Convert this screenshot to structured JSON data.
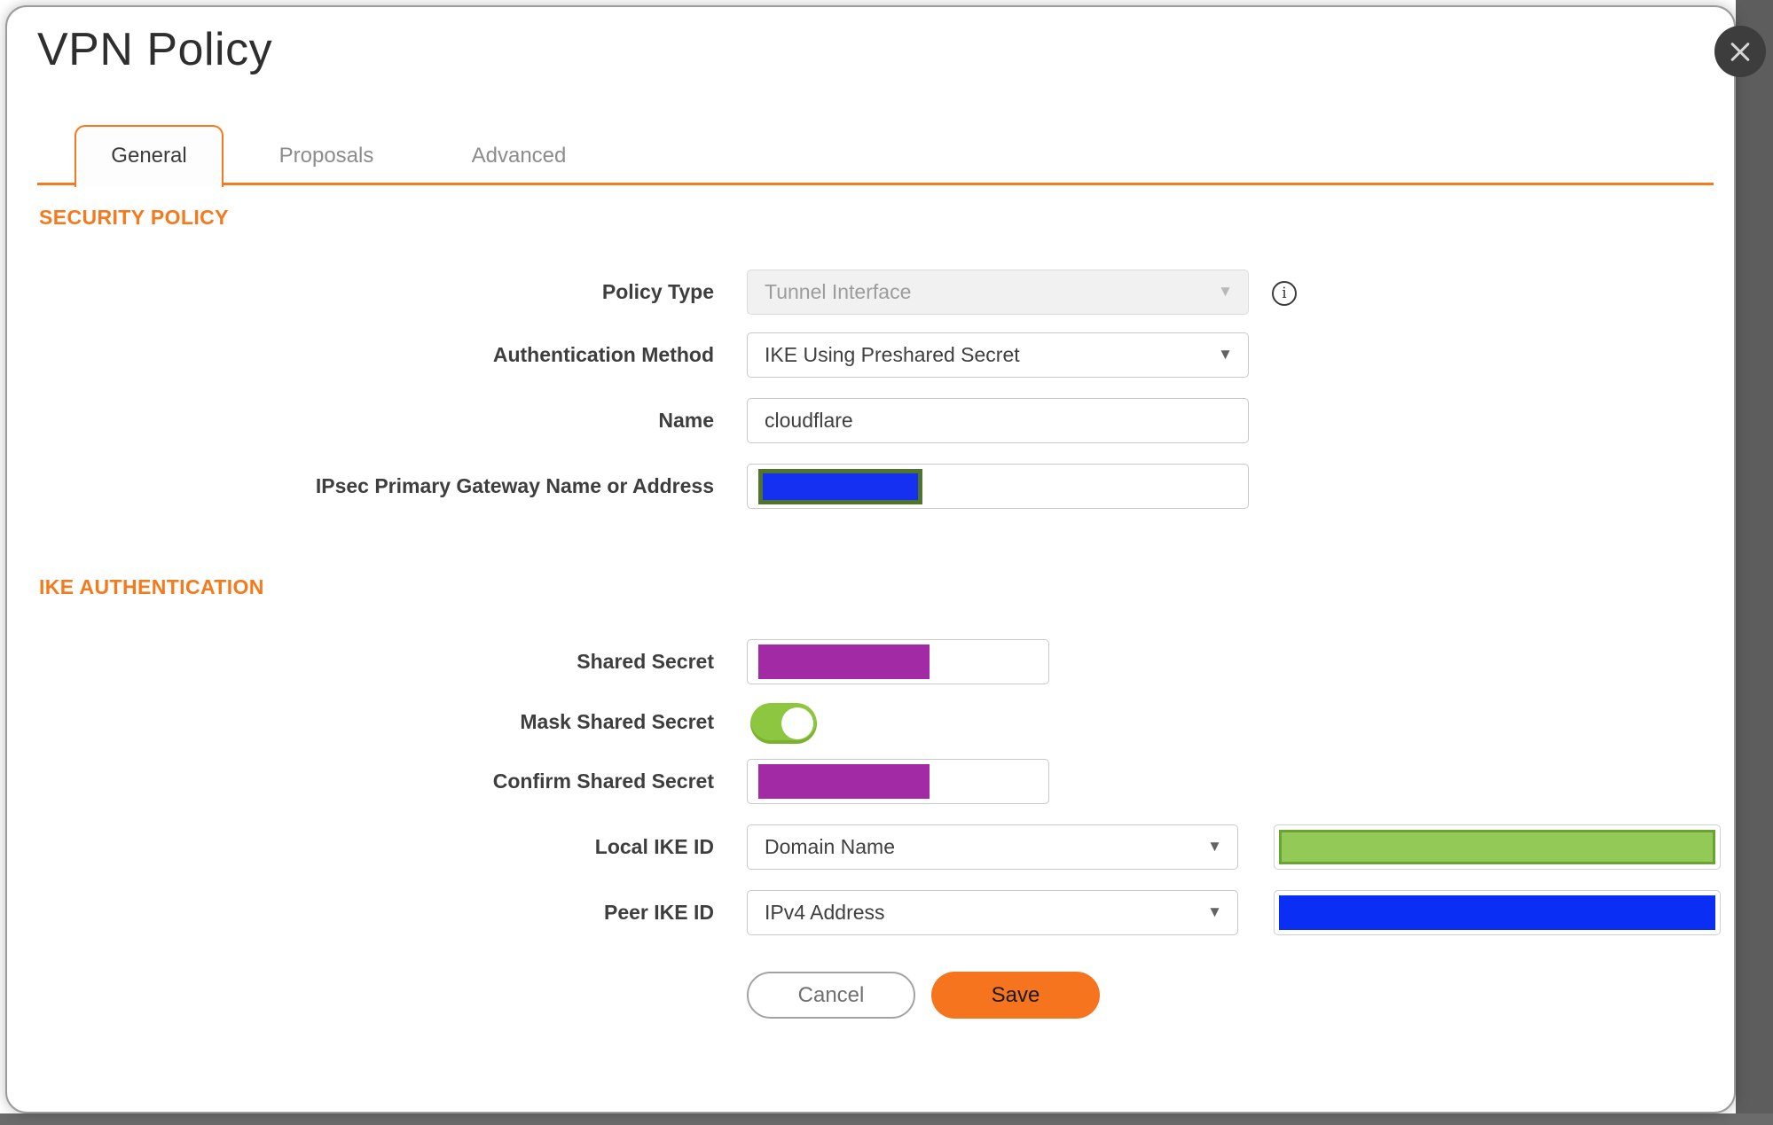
{
  "title": "VPN Policy",
  "tabs": {
    "general": "General",
    "proposals": "Proposals",
    "advanced": "Advanced",
    "active_tab": "General"
  },
  "sections": {
    "security_policy": "SECURITY POLICY",
    "ike_authentication": "IKE AUTHENTICATION"
  },
  "fields": {
    "policy_type": {
      "label": "Policy Type",
      "value": "Tunnel Interface",
      "disabled": true
    },
    "authentication_method": {
      "label": "Authentication Method",
      "value": "IKE Using Preshared Secret"
    },
    "name": {
      "label": "Name",
      "value": "cloudflare"
    },
    "ipsec_gateway": {
      "label": "IPsec Primary Gateway Name or Address",
      "value_state": "redacted"
    },
    "shared_secret": {
      "label": "Shared Secret",
      "value_state": "redacted"
    },
    "mask_shared_secret": {
      "label": "Mask Shared Secret",
      "state": "on"
    },
    "confirm_shared_secret": {
      "label": "Confirm Shared Secret",
      "value_state": "redacted"
    },
    "local_ike_id": {
      "label": "Local IKE ID",
      "value": "Domain Name",
      "id_value_state": "redacted"
    },
    "peer_ike_id": {
      "label": "Peer IKE ID",
      "value": "IPv4 Address",
      "id_value_state": "redacted"
    }
  },
  "buttons": {
    "cancel": "Cancel",
    "save": "Save"
  },
  "icons": {
    "close": "✕",
    "info": "i",
    "dropdown": "▼"
  },
  "colors": {
    "accent_orange": "#F5791D",
    "save_button_orange": "#F6741D",
    "toggle_green": "#8DC63F",
    "redaction_purple": "#A22AA5",
    "redaction_blue_gateway": "#1530F0",
    "redaction_olive_border": "#4F752C",
    "redaction_green_fill": "#93C957",
    "redaction_green_border": "#69A432",
    "redaction_blue_peer": "#0B2EF5",
    "background_gray": "#5D5D5D"
  }
}
